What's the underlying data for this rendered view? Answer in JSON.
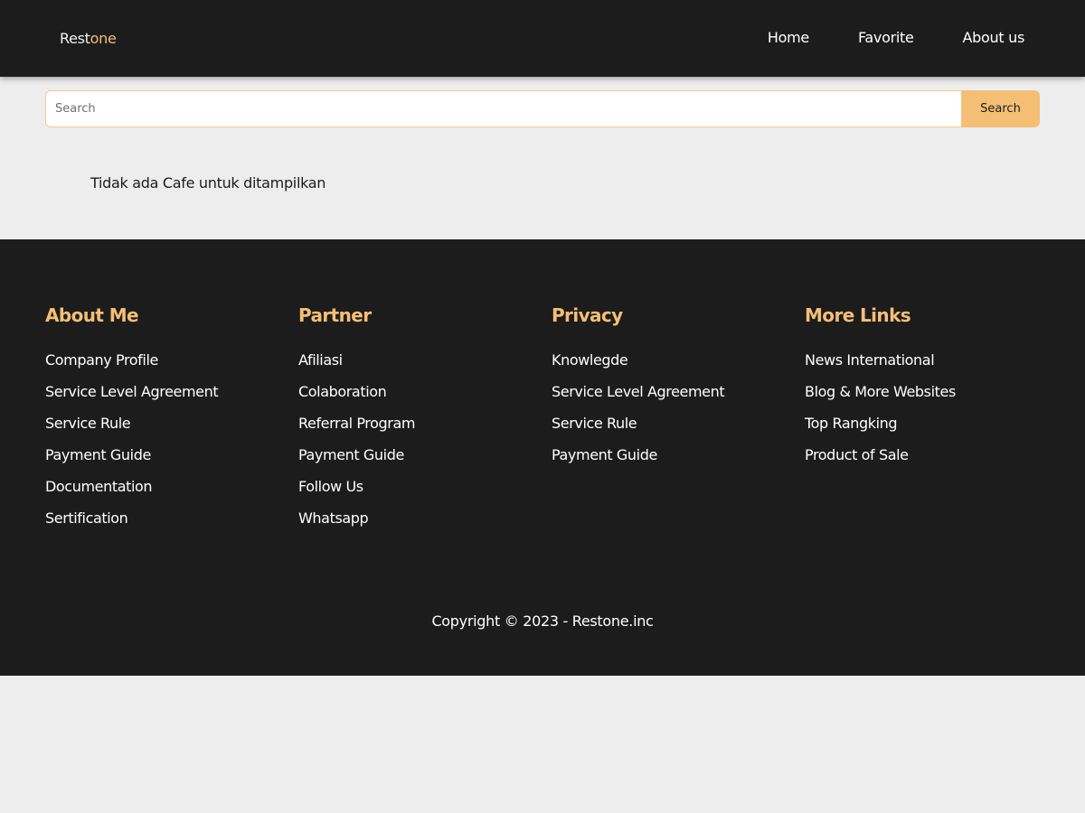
{
  "header": {
    "brand_part1": "Rest",
    "brand_part2": "one",
    "nav": [
      {
        "label": "Home"
      },
      {
        "label": "Favorite"
      },
      {
        "label": "About us"
      }
    ]
  },
  "search": {
    "placeholder": "Search",
    "value": "",
    "button_label": "Search"
  },
  "main": {
    "empty_message": "Tidak ada Cafe untuk ditampilkan"
  },
  "footer": {
    "columns": [
      {
        "title": "About Me",
        "links": [
          "Company Profile",
          "Service Level Agreement",
          "Service Rule",
          "Payment Guide",
          "Documentation",
          "Sertification"
        ]
      },
      {
        "title": "Partner",
        "links": [
          "Afiliasi",
          "Colaboration",
          "Referral Program",
          "Payment Guide",
          "Follow Us",
          "Whatsapp"
        ]
      },
      {
        "title": "Privacy",
        "links": [
          "Knowlegde",
          "Service Level Agreement",
          "Service Rule",
          "Payment Guide"
        ]
      },
      {
        "title": "More Links",
        "links": [
          "News International",
          "Blog & More Websites",
          "Top Rangking",
          "Product of Sale"
        ]
      }
    ],
    "copyright": "Copyright © 2023 - Restone.inc"
  },
  "colors": {
    "dark": "#1c1c1c",
    "accent": "#f4bf75",
    "background": "#ededed"
  }
}
